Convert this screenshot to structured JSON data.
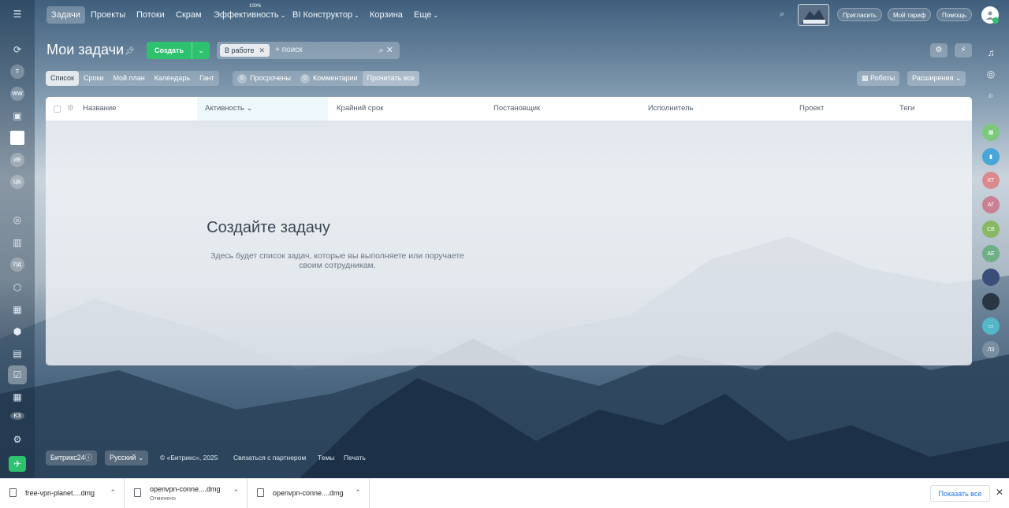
{
  "nav": {
    "items": [
      "Задачи",
      "Проекты",
      "Потоки",
      "Скрам",
      "Эффективность",
      "BI Конструктор",
      "Корзина",
      "Еще"
    ],
    "efficiency_badge": "100%",
    "invite": "Пригласить",
    "tariff": "Мой тариф",
    "help": "Помощь"
  },
  "left_rail": {
    "avatars": [
      "Т",
      "WW",
      "ИЕ",
      "ЦБ",
      "ПД",
      "КЗ"
    ]
  },
  "right_rail": {
    "avatars": [
      "КТ",
      "АГ",
      "СВ",
      "АЕ",
      "ЛЗ"
    ]
  },
  "header": {
    "title": "Мои задачи",
    "create": "Создать",
    "filter_chip": "В работе",
    "search_placeholder": "+ поиск"
  },
  "views": [
    "Список",
    "Сроки",
    "Мой план",
    "Календарь",
    "Гант"
  ],
  "counters": {
    "overdue_count": "0",
    "overdue": "Просрочены",
    "comments_count": "0",
    "comments": "Комментарии",
    "read_all": "Прочитать все"
  },
  "right_buttons": {
    "robots": "Роботы",
    "extensions": "Расширения"
  },
  "table": {
    "columns": [
      "Название",
      "Активность",
      "Крайний срок",
      "Постановщик",
      "Исполнитель",
      "Проект",
      "Теги"
    ]
  },
  "empty": {
    "title": "Создайте задачу",
    "subtitle": "Здесь будет список задач, которые вы выполняете или поручаете своим сотрудникам."
  },
  "footer": {
    "brand": "Битрикс24",
    "language": "Русский",
    "copyright": "© «Битрикс», 2025",
    "partner": "Связаться с партнером",
    "themes": "Темы",
    "print": "Печать"
  },
  "downloads": {
    "items": [
      {
        "name": "free-vpn-planet....dmg",
        "status": ""
      },
      {
        "name": "openvpn-conne....dmg",
        "status": "Отменено"
      },
      {
        "name": "openvpn-conne....dmg",
        "status": ""
      }
    ],
    "show_all": "Показать все"
  }
}
